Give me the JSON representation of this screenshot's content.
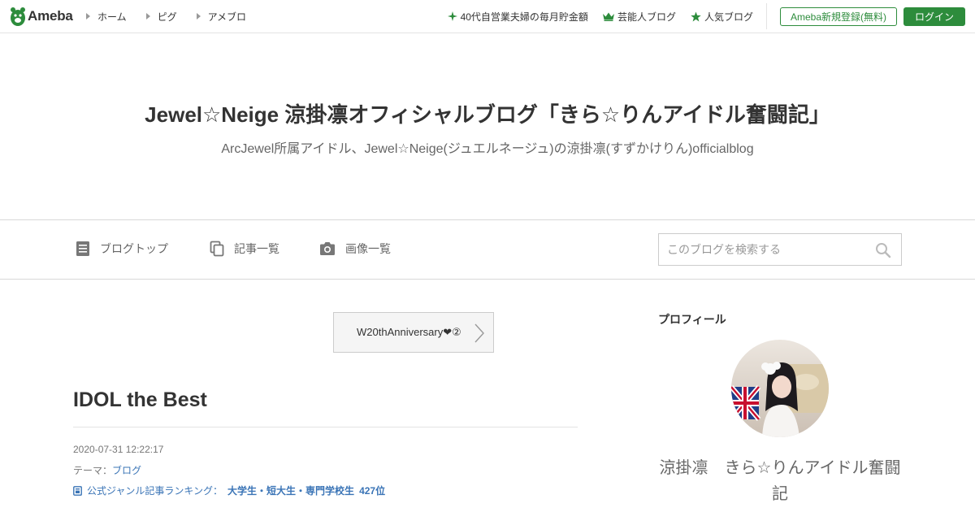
{
  "topbar": {
    "logo_text": "Ameba",
    "nav": [
      {
        "label": "ホーム"
      },
      {
        "label": "ピグ"
      },
      {
        "label": "アメブロ"
      }
    ],
    "right_links": [
      {
        "label": "40代自営業夫婦の毎月貯金額",
        "icon": "sparkle-icon"
      },
      {
        "label": "芸能人ブログ",
        "icon": "crown-icon"
      },
      {
        "label": "人気ブログ",
        "icon": "star-icon"
      }
    ],
    "register_label": "Ameba新規登録(無料)",
    "login_label": "ログイン",
    "brand_color": "#2d8c3c"
  },
  "header": {
    "title": "Jewel☆Neige 涼掛凛オフィシャルブログ「きら☆りんアイドル奮闘記」",
    "description": "ArcJewel所属アイドル、Jewel☆Neige(ジュエルネージュ)の涼掛凛(すずかけりん)officialblog"
  },
  "subnav": {
    "items": [
      {
        "label": "ブログトップ",
        "icon": "document-icon"
      },
      {
        "label": "記事一覧",
        "icon": "copy-icon"
      },
      {
        "label": "画像一覧",
        "icon": "camera-icon"
      }
    ],
    "search_placeholder": "このブログを検索する"
  },
  "entry": {
    "prev_title": "W20thAnniversary❤②",
    "title": "IDOL the Best",
    "date": "2020-07-31 12:22:17",
    "theme_label": "テーマ：",
    "theme_value": "ブログ",
    "ranking_label": "公式ジャンル記事ランキング：",
    "ranking_genre": "大学生・短大生・専門学校生",
    "ranking_rank": "427位",
    "link_color": "#3a74b6"
  },
  "sidebar": {
    "heading": "プロフィール",
    "profile_name": "涼掛凛　きら☆りんアイドル奮闘記"
  }
}
